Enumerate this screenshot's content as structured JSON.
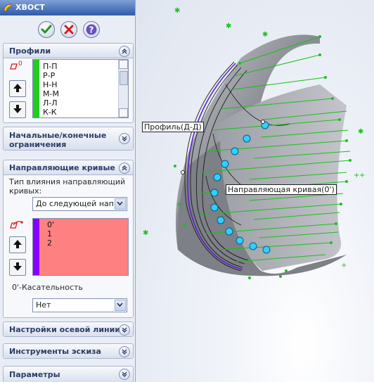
{
  "feature": {
    "title": "ХВОСТ",
    "icon": "sweep-feature-icon"
  },
  "actions": {
    "ok": "check-icon",
    "cancel": "cross-icon",
    "help": "question-icon"
  },
  "profiles": {
    "title": "Профили",
    "items": [
      "П-П",
      "Р-Р",
      "Н-Н",
      "М-М",
      "Л-Л",
      "К-К"
    ],
    "bar_color": "#22cc22"
  },
  "start_end": {
    "title_line1": "Начальные/конечные",
    "title_line2": "ограничения"
  },
  "guides": {
    "title": "Направляющие кривые",
    "type_label_line1": "Тип влияния направляющий",
    "type_label_line2": "кривых:",
    "type_value": "До следующей напра",
    "items": [
      "0'",
      "1",
      "2"
    ],
    "bar_color": "#8a00ff",
    "list_bg": "#ff8080",
    "tangency_label": "0'-Касательность",
    "tangency_value": "Нет"
  },
  "centerline": {
    "title": "Настройки осевой линии"
  },
  "sketch_tools": {
    "title": "Инструменты эскиза"
  },
  "options": {
    "title": "Параметры"
  },
  "viewport": {
    "profile_tag": "Профиль(Д-Д)",
    "guide_tag": "Направляющая кривая(0')"
  }
}
